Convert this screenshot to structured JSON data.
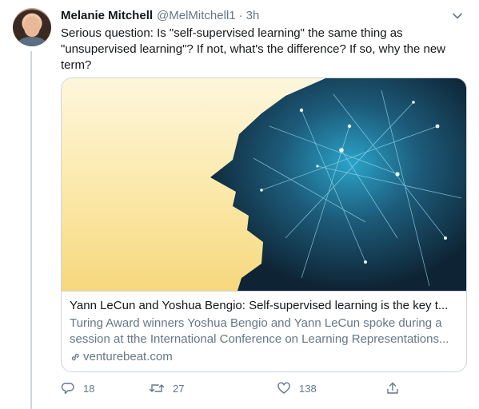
{
  "tweet": {
    "author_name": "Melanie Mitchell",
    "author_handle": "@MelMitchell1",
    "separator": "·",
    "time": "3h",
    "text": "Serious question:  Is \"self-supervised learning\" the same thing as \"unsupervised learning\"?  If not, what's the difference?  If so, why the new term?"
  },
  "card": {
    "title": "Yann LeCun and Yoshua Bengio: Self-supervised learning is the key t...",
    "description": "Turing Award winners Yoshua Bengio and Yann LeCun spoke during a session at tthe International Conference on Learning Representations...",
    "domain": "venturebeat.com"
  },
  "actions": {
    "replies": "18",
    "retweets": "27",
    "likes": "138"
  },
  "icons": {
    "caret": "chevron-down-icon",
    "reply": "reply-icon",
    "retweet": "retweet-icon",
    "like": "heart-icon",
    "share": "share-icon",
    "link": "link-icon"
  },
  "colors": {
    "text": "#14171a",
    "secondary": "#657786",
    "border": "#ccd6dd"
  }
}
